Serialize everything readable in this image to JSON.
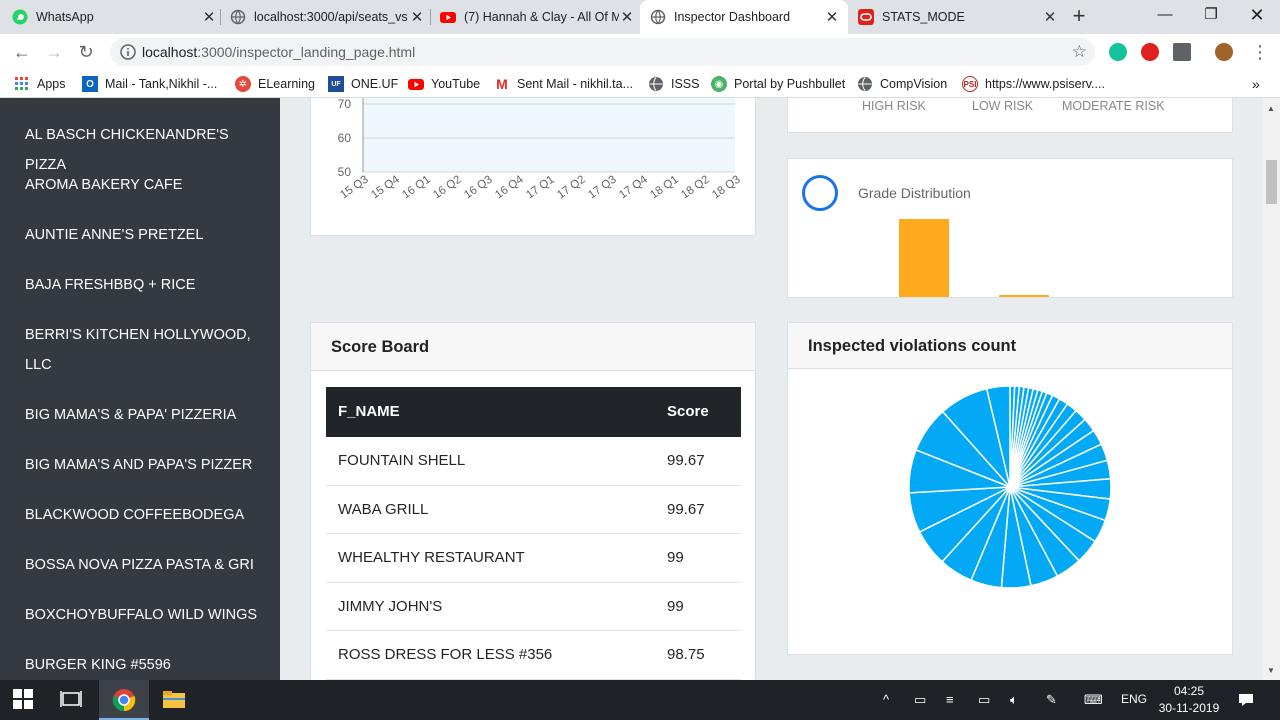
{
  "browser": {
    "tabs": [
      {
        "title": "WhatsApp",
        "icon": "whatsapp-icon"
      },
      {
        "title": "localhost:3000/api/seats_vs",
        "icon": "globe-icon"
      },
      {
        "title": "(7) Hannah & Clay - All Of M",
        "icon": "youtube-icon"
      },
      {
        "title": "Inspector Dashboard",
        "icon": "globe-icon",
        "active": true
      },
      {
        "title": "STATS_MODE",
        "icon": "oracle-icon"
      }
    ],
    "url_host": "localhost",
    "url_path": ":3000/inspector_landing_page.html",
    "bookmarks": [
      {
        "label": "Apps",
        "icon": "apps-grid-icon"
      },
      {
        "label": "Mail - Tank,Nikhil -...",
        "icon": "outlook-icon"
      },
      {
        "label": "ELearning",
        "icon": "elearning-icon"
      },
      {
        "label": "ONE.UF",
        "icon": "oneuf-icon"
      },
      {
        "label": "YouTube",
        "icon": "youtube-icon"
      },
      {
        "label": "Sent Mail - nikhil.ta...",
        "icon": "gmail-icon"
      },
      {
        "label": "ISSS",
        "icon": "globe-icon"
      },
      {
        "label": "Portal by Pushbullet",
        "icon": "pushbullet-icon"
      },
      {
        "label": "CompVision",
        "icon": "globe-icon"
      },
      {
        "label": "https://www.psiserv....",
        "icon": "psi-icon"
      }
    ],
    "more_bookmarks": "»"
  },
  "sidebar": {
    "items": [
      "AL BASCH CHICKENANDRE'S PIZZA",
      "AROMA BAKERY CAFE",
      "AUNTIE ANNE'S PRETZEL",
      "BAJA FRESHBBQ + RICE",
      "BERRI'S KITCHEN HOLLYWOOD, LLC",
      "BIG MAMA'S & PAPA' PIZZERIA",
      "BIG MAMA'S AND PAPA'S PIZZER",
      "BLACKWOOD COFFEEBODEGA",
      "BOSSA NOVA PIZZA PASTA & GRI",
      "BOXCHOYBUFFALO WILD WINGS",
      "BURGER KING #5596"
    ]
  },
  "trend_chart": {
    "y_ticks": [
      "70",
      "60",
      "50"
    ],
    "x_ticks": [
      "15 Q3",
      "15 Q4",
      "16 Q1",
      "16 Q2",
      "16 Q3",
      "16 Q4",
      "17 Q1",
      "17 Q2",
      "17 Q3",
      "17 Q4",
      "18 Q1",
      "18 Q2",
      "18 Q3"
    ],
    "fill_color": "#eef7fb"
  },
  "risk_legend": [
    "HIGH RISK",
    "LOW RISK",
    "MODERATE RISK"
  ],
  "grade": {
    "title": "Grade Distribution",
    "bar_color": "#ffaa1c",
    "bars": [
      1.0,
      0.09,
      0.0
    ]
  },
  "scoreboard": {
    "title": "Score Board",
    "columns": [
      "F_NAME",
      "Score"
    ],
    "rows": [
      {
        "name": "FOUNTAIN SHELL",
        "score": "99.67"
      },
      {
        "name": "WABA GRILL",
        "score": "99.67"
      },
      {
        "name": "WHEALTHY RESTAURANT",
        "score": "99"
      },
      {
        "name": "JIMMY JOHN'S",
        "score": "99"
      },
      {
        "name": "ROSS DRESS FOR LESS #356",
        "score": "98.75"
      }
    ]
  },
  "violations": {
    "title": "Inspected violations count",
    "color": "#03a9f4",
    "slices_deg": [
      3,
      3,
      3,
      3,
      3,
      3,
      3,
      3,
      4,
      5,
      6,
      7,
      8,
      9,
      10,
      11,
      12,
      13,
      14,
      15,
      16,
      17,
      18,
      19,
      20,
      22,
      24,
      26,
      28,
      30,
      32,
      15
    ]
  },
  "taskbar": {
    "lang": "ENG",
    "time": "04:25",
    "date": "30-11-2019"
  }
}
